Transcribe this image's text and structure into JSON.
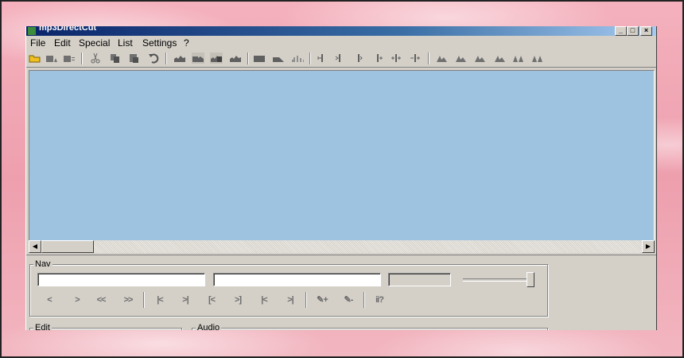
{
  "window": {
    "title": "mp3DirectCut",
    "controls": [
      "_",
      "□",
      "×"
    ]
  },
  "menu": [
    "File",
    "Edit",
    "Special",
    "List",
    "Settings",
    "?"
  ],
  "toolbar": {
    "icons": [
      "open-folder-icon",
      "save-icon",
      "save-all-icon",
      "cut-icon",
      "copy-icon",
      "paste-icon",
      "undo-icon",
      "select-wave-1-icon",
      "select-wave-2-icon",
      "select-wave-3-icon",
      "select-wave-4-icon",
      "volume-block-icon",
      "fade-block-icon",
      "waveform-block-icon",
      "marker-1-icon",
      "marker-2-icon",
      "marker-3-icon",
      "marker-4-icon",
      "marker-5-icon",
      "marker-6-icon",
      "level-1-icon",
      "level-2-icon",
      "level-3-icon",
      "level-4-icon",
      "level-5-icon",
      "level-6-icon"
    ]
  },
  "colors": {
    "wave_bg": "#9dc3e0",
    "face": "#d4d0c8"
  },
  "nav": {
    "label": "Nav",
    "field1": "",
    "field2": "",
    "field3": "",
    "buttons": [
      "<",
      ">",
      "<<",
      ">>",
      "|<",
      ">|",
      "[<",
      ">]",
      "|<",
      ">|",
      "✎+",
      "✎-",
      "ii?"
    ]
  },
  "edit_group": {
    "label": "Edit"
  },
  "audio_group": {
    "label": "Audio"
  }
}
